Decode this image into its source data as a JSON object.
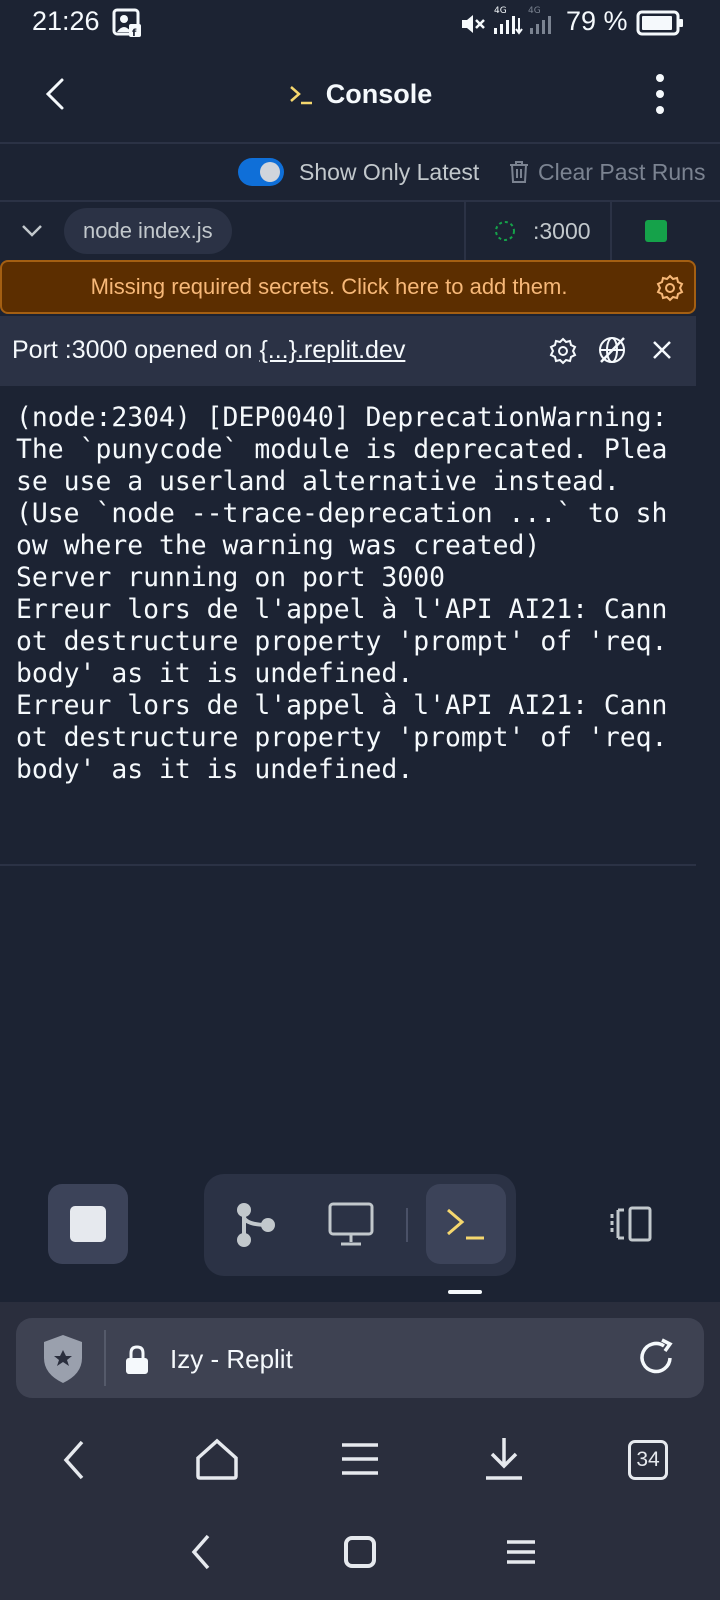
{
  "status_bar": {
    "time": "21:26",
    "battery": "79 %",
    "network_label": "4G"
  },
  "header": {
    "title": "Console",
    "title_icon": "terminal-prompt-icon"
  },
  "toolbar": {
    "show_latest_label": "Show Only Latest",
    "show_latest_on": true,
    "clear_label": "Clear Past Runs"
  },
  "run_bar": {
    "command": "node index.js",
    "port": ":3000",
    "running": true
  },
  "secrets_banner": {
    "text": "Missing required secrets. Click here to add them."
  },
  "port_panel": {
    "prefix": "Port :3000 opened on ",
    "link": "{...}.replit.dev"
  },
  "console": {
    "output": "(node:2304) [DEP0040] DeprecationWarning: The `punycode` module is deprecated. Please use a userland alternative instead.\n(Use `node --trace-deprecation ...` to show where the warning was created)\nServer running on port 3000\nErreur lors de l'appel à l'API AI21: Cannot destructure property 'prompt' of 'req.body' as it is undefined.\nErreur lors de l'appel à l'API AI21: Cannot destructure property 'prompt' of 'req.body' as it is undefined."
  },
  "browser": {
    "page_title": "Izy - Replit",
    "tab_count": "34"
  },
  "colors": {
    "background": "#1c2333",
    "surface": "#2b3245",
    "accent_blue": "#0f6fd8",
    "warning_bg": "#5c2e00",
    "warning_text": "#f7b878",
    "running_green": "#15a24a",
    "prompt_yellow": "#f5d76e"
  }
}
